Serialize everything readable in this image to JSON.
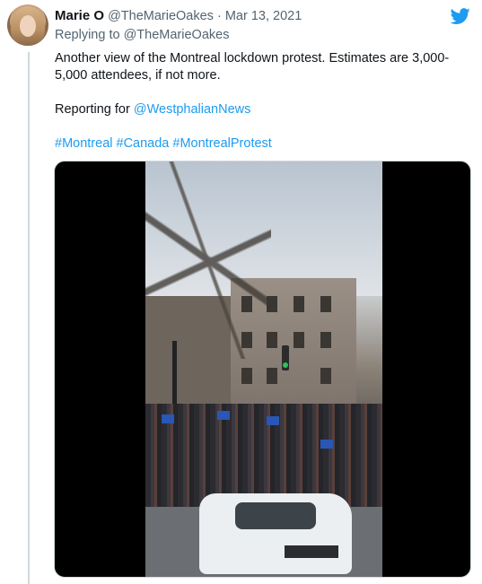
{
  "tweet": {
    "name": "Marie O",
    "handle": "@TheMarieOakes",
    "separator": "·",
    "date": "Mar 13, 2021",
    "replying_prefix": "Replying to",
    "replying_to": "@TheMarieOakes",
    "text_line1": "Another view of the Montreal lockdown protest. Estimates are 3,000-5,000 attendees, if not more.",
    "reporting_prefix": "Reporting for ",
    "reporting_mention": "@WestphalianNews",
    "hashtags": [
      "#Montreal",
      "#Canada",
      "#MontrealProtest"
    ]
  },
  "icons": {
    "avatar": "profile-photo",
    "brand": "twitter-bird-icon"
  },
  "colors": {
    "link": "#1d9bf0",
    "text": "#0f1419",
    "muted": "#536471"
  }
}
